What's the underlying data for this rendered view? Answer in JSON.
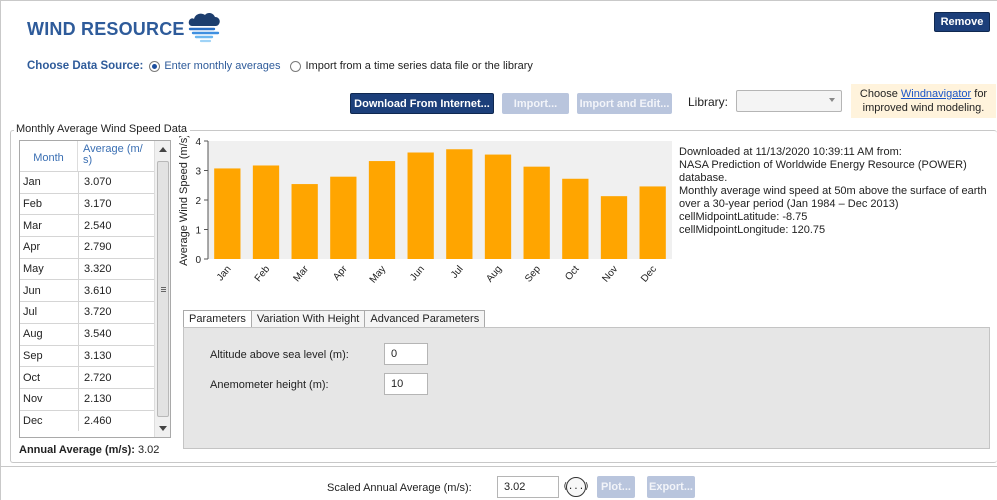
{
  "header": {
    "title": "WIND RESOURCE",
    "remove_label": "Remove"
  },
  "data_source": {
    "label": "Choose Data Source:",
    "option_monthly": "Enter monthly averages",
    "option_import": "Import from a time series data file or the library",
    "selected": "option_monthly"
  },
  "toolbar": {
    "download_label": "Download From Internet...",
    "import_label": "Import...",
    "import_edit_label": "Import and Edit...",
    "library_label": "Library:",
    "library_value": ""
  },
  "windnavigator": {
    "prefix": "Choose ",
    "link": "Windnavigator",
    "suffix": " for",
    "line2": "improved wind modeling."
  },
  "group": {
    "label": "Monthly Average Wind Speed Data"
  },
  "table": {
    "col_month": "Month",
    "col_average_1": "Average (m/",
    "col_average_2": "s)",
    "rows": [
      {
        "month": "Jan",
        "value": "3.070"
      },
      {
        "month": "Feb",
        "value": "3.170"
      },
      {
        "month": "Mar",
        "value": "2.540"
      },
      {
        "month": "Apr",
        "value": "2.790"
      },
      {
        "month": "May",
        "value": "3.320"
      },
      {
        "month": "Jun",
        "value": "3.610"
      },
      {
        "month": "Jul",
        "value": "3.720"
      },
      {
        "month": "Aug",
        "value": "3.540"
      },
      {
        "month": "Sep",
        "value": "3.130"
      },
      {
        "month": "Oct",
        "value": "2.720"
      },
      {
        "month": "Nov",
        "value": "2.130"
      },
      {
        "month": "Dec",
        "value": "2.460"
      }
    ]
  },
  "annual": {
    "label": "Annual Average (m/s):",
    "value": "3.02"
  },
  "chart_data": {
    "type": "bar",
    "categories": [
      "Jan",
      "Feb",
      "Mar",
      "Apr",
      "May",
      "Jun",
      "Jul",
      "Aug",
      "Sep",
      "Oct",
      "Nov",
      "Dec"
    ],
    "values": [
      3.07,
      3.17,
      2.54,
      2.79,
      3.32,
      3.61,
      3.72,
      3.54,
      3.13,
      2.72,
      2.13,
      2.46
    ],
    "ylabel": "Average Wind Speed (m/s)",
    "ylim": [
      0,
      4
    ],
    "yticks": [
      "0",
      "1",
      "2",
      "3",
      "4"
    ],
    "bar_color": "#FFA500",
    "plot_bg": "#F0F0F0",
    "grid": false
  },
  "info": {
    "lines": [
      "Downloaded at 11/13/2020 10:39:11 AM from:",
      "NASA Prediction of Worldwide Energy Resource (POWER)",
      "database.",
      "Monthly average wind speed at 50m above the surface of earth",
      "over a 30-year period (Jan 1984 – Dec 2013)",
      "cellMidpointLatitude: -8.75",
      "cellMidpointLongitude: 120.75"
    ]
  },
  "tabs": {
    "items": [
      "Parameters",
      "Variation With Height",
      "Advanced Parameters"
    ],
    "active": 0
  },
  "parameters": {
    "altitude_label": "Altitude above sea level (m):",
    "altitude_value": "0",
    "anemometer_label": "Anemometer height (m):",
    "anemometer_value": "10"
  },
  "bottom": {
    "scaled_label": "Scaled Annual Average (m/s):",
    "scaled_value": "3.02",
    "scale_button_glyph": "(...)",
    "plot_label": "Plot...",
    "export_label": "Export..."
  }
}
